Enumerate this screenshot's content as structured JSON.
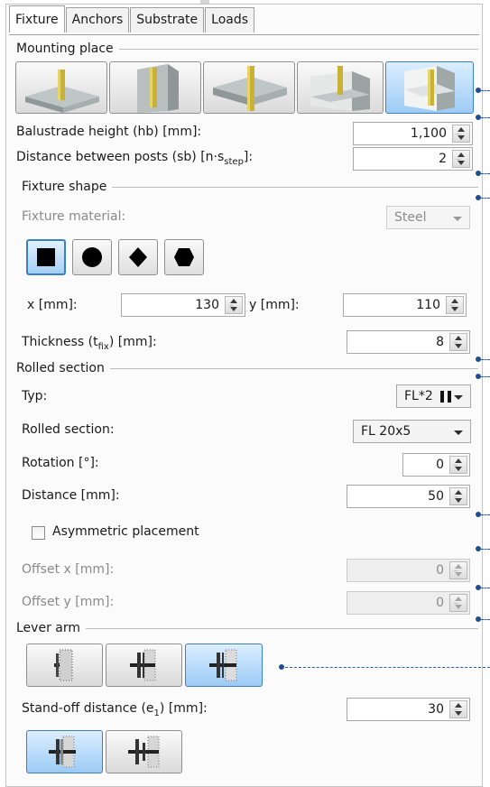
{
  "tabs": [
    "Fixture",
    "Anchors",
    "Substrate",
    "Loads"
  ],
  "active_tab": "Fixture",
  "sections": {
    "mounting_place": "Mounting place",
    "fixture_shape": "Fixture shape",
    "rolled_section": "Rolled section",
    "lever_arm": "Lever arm"
  },
  "mounting_options": [
    {
      "icon": "mount-top-on-slab-icon",
      "selected": false
    },
    {
      "icon": "mount-front-of-slab-icon",
      "selected": false
    },
    {
      "icon": "mount-side-slab-icon",
      "selected": false
    },
    {
      "icon": "mount-corner-top-icon",
      "selected": false
    },
    {
      "icon": "mount-corner-inside-icon",
      "selected": true
    }
  ],
  "balustrade": {
    "label": "Balustrade height (hb) [mm]:",
    "value": "1,100"
  },
  "posts": {
    "label_main": "Distance between posts (sb) [n·s",
    "label_sub": "step",
    "label_end": "]:",
    "value": "2"
  },
  "fixture_material": {
    "label": "Fixture material:",
    "value": "Steel"
  },
  "shapes": [
    {
      "icon": "square-icon",
      "selected": true
    },
    {
      "icon": "circle-icon",
      "selected": false
    },
    {
      "icon": "diamond-icon",
      "selected": false
    },
    {
      "icon": "hexagon-icon",
      "selected": false
    }
  ],
  "x_field": {
    "label": "x [mm]:",
    "value": "130"
  },
  "y_field": {
    "label": "y [mm]:",
    "value": "110"
  },
  "thickness": {
    "label_main": "Thickness (t",
    "label_sub": "fix",
    "label_end": ") [mm]:",
    "value": "8"
  },
  "typ": {
    "label": "Typ:",
    "value": "FL*2"
  },
  "rolled_section_field": {
    "label": "Rolled section:",
    "value": "FL 20x5"
  },
  "rotation": {
    "label": "Rotation [°]:",
    "value": "0"
  },
  "distance": {
    "label": "Distance [mm]:",
    "value": "50"
  },
  "asymmetric": {
    "label": "Asymmetric placement",
    "checked": false
  },
  "offset_x": {
    "label": "Offset x [mm]:",
    "value": "0"
  },
  "offset_y": {
    "label": "Offset y [mm]:",
    "value": "0"
  },
  "lever_options": [
    {
      "icon": "lever-profile-dotted-icon",
      "selected": false
    },
    {
      "icon": "lever-profile-centered-icon",
      "selected": false
    },
    {
      "icon": "lever-profile-offset-icon",
      "selected": true
    }
  ],
  "standoff": {
    "label_main": "Stand-off distance (e",
    "label_sub": "1",
    "label_end": ") [mm]:",
    "value": "30"
  },
  "standoff_options": [
    {
      "icon": "standoff-grout-icon",
      "selected": true
    },
    {
      "icon": "standoff-nut-icon",
      "selected": false
    }
  ],
  "colors": {
    "accent": "#3b7fc4",
    "leader": "#1f4f93"
  }
}
